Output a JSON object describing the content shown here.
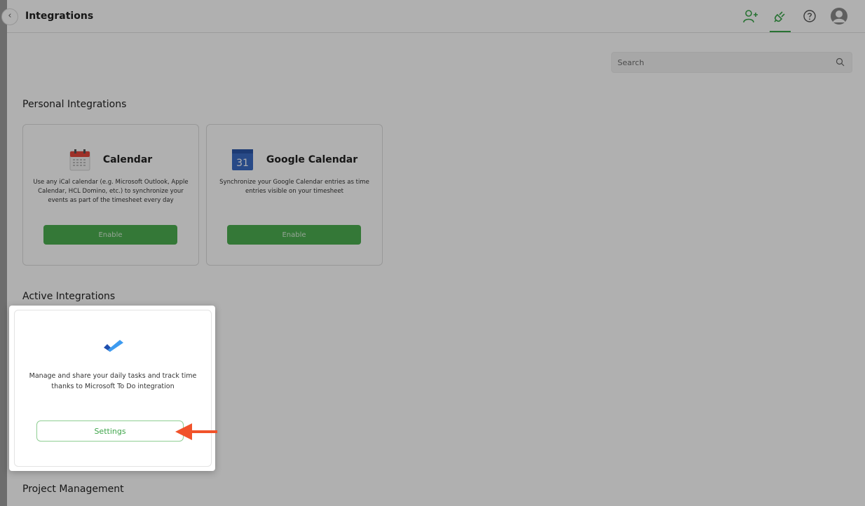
{
  "header": {
    "title": "Integrations"
  },
  "search": {
    "placeholder": "Search"
  },
  "sections": {
    "personal": "Personal Integrations",
    "active": "Active Integrations",
    "project": "Project Management"
  },
  "cards": [
    {
      "name": "Calendar",
      "description": "Use any iCal calendar (e.g. Microsoft Outlook, Apple Calendar, HCL Domino, etc.) to synchronize your events as part of the timesheet every day",
      "button": "Enable",
      "icon": "calendar-icon"
    },
    {
      "name": "Google Calendar",
      "description": "Synchronize your Google Calendar entries as time entries visible on your timesheet",
      "button": "Enable",
      "icon": "google-calendar-icon",
      "icon_text": "31"
    }
  ],
  "active_card": {
    "description": "Manage and share your daily tasks and track time thanks to Microsoft To Do integration",
    "button": "Settings",
    "icon": "microsoft-todo-icon"
  },
  "colors": {
    "accent": "#3aa64b",
    "enable_button": "#4caf50",
    "arrow": "#f1532b"
  }
}
